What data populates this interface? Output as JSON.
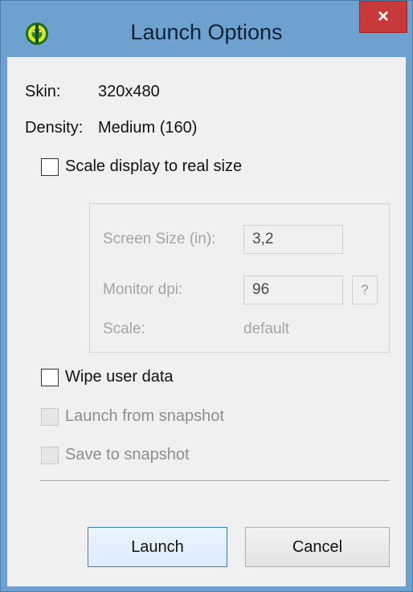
{
  "window": {
    "title": "Launch Options",
    "close_symbol": "×",
    "app_icon": "android-avd-icon"
  },
  "info": {
    "skin_label": "Skin:",
    "skin_value": "320x480",
    "density_label": "Density:",
    "density_value": "Medium (160)"
  },
  "options": {
    "scale_display": {
      "label": "Scale display to real size",
      "checked": false,
      "enabled": true
    },
    "wipe_user_data": {
      "label": "Wipe user data",
      "checked": false,
      "enabled": true
    },
    "launch_from_snapshot": {
      "label": "Launch from snapshot",
      "checked": false,
      "enabled": false
    },
    "save_to_snapshot": {
      "label": "Save to snapshot",
      "checked": false,
      "enabled": false
    }
  },
  "scale_group": {
    "screen_size_label": "Screen Size (in):",
    "screen_size_value": "3,2",
    "monitor_dpi_label": "Monitor dpi:",
    "monitor_dpi_value": "96",
    "help_label": "?",
    "scale_label": "Scale:",
    "scale_value": "default"
  },
  "buttons": {
    "launch": "Launch",
    "cancel": "Cancel"
  },
  "colors": {
    "frame": "#6fa1cf",
    "close": "#c7393a",
    "client": "#f0f0f0",
    "default_button_border": "#3c7fb1"
  }
}
